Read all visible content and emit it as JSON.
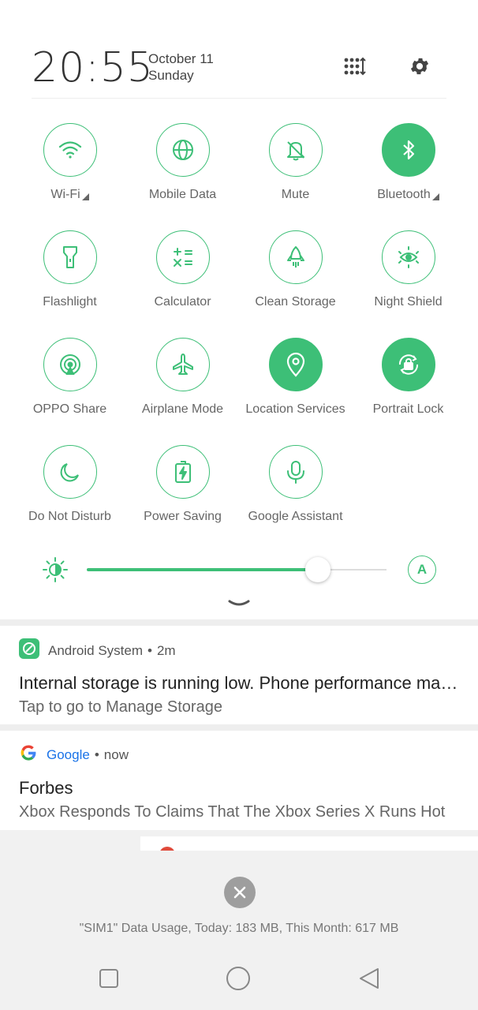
{
  "header": {
    "time": "20:55",
    "date": "October 11",
    "day": "Sunday",
    "edit_icon": "grid-sort-icon",
    "settings_icon": "gear-icon"
  },
  "tiles": [
    {
      "label": "Wi-Fi",
      "icon": "wifi-icon",
      "active": false,
      "expandable": true
    },
    {
      "label": "Mobile Data",
      "icon": "globe-icon",
      "active": false,
      "expandable": false
    },
    {
      "label": "Mute",
      "icon": "bell-off-icon",
      "active": false,
      "expandable": false
    },
    {
      "label": "Bluetooth",
      "icon": "bluetooth-icon",
      "active": true,
      "expandable": true
    },
    {
      "label": "Flashlight",
      "icon": "flashlight-icon",
      "active": false,
      "expandable": false
    },
    {
      "label": "Calculator",
      "icon": "calculator-icon",
      "active": false,
      "expandable": false
    },
    {
      "label": "Clean Storage",
      "icon": "rocket-icon",
      "active": false,
      "expandable": false
    },
    {
      "label": "Night Shield",
      "icon": "eye-icon",
      "active": false,
      "expandable": false
    },
    {
      "label": "OPPO Share",
      "icon": "share-signal-icon",
      "active": false,
      "expandable": false
    },
    {
      "label": "Airplane Mode",
      "icon": "airplane-icon",
      "active": false,
      "expandable": false
    },
    {
      "label": "Location Services",
      "icon": "location-pin-icon",
      "active": true,
      "expandable": false
    },
    {
      "label": "Portrait Lock",
      "icon": "rotation-lock-icon",
      "active": true,
      "expandable": false
    },
    {
      "label": "Do Not Disturb",
      "icon": "moon-icon",
      "active": false,
      "expandable": false
    },
    {
      "label": "Power Saving",
      "icon": "battery-bolt-icon",
      "active": false,
      "expandable": false
    },
    {
      "label": "Google Assistant",
      "icon": "microphone-icon",
      "active": false,
      "expandable": false
    }
  ],
  "brightness": {
    "level": 0.77,
    "auto_label": "A",
    "icon": "brightness-sun-icon"
  },
  "notifications": [
    {
      "app": "Android System",
      "time": "2m",
      "title": "Internal storage is running low. Phone performance may be affected.",
      "body": "Tap to go to Manage Storage",
      "app_color": "#555555"
    },
    {
      "app": "Google",
      "time": "now",
      "title": "Forbes",
      "body": "Xbox Responds To Claims That The Xbox Series X Runs Hot",
      "app_color": "#1a73e8"
    }
  ],
  "footer": {
    "data_usage": "\"SIM1\" Data Usage, Today: 183 MB, This Month: 617 MB"
  },
  "colors": {
    "accent": "#3dbf77"
  }
}
